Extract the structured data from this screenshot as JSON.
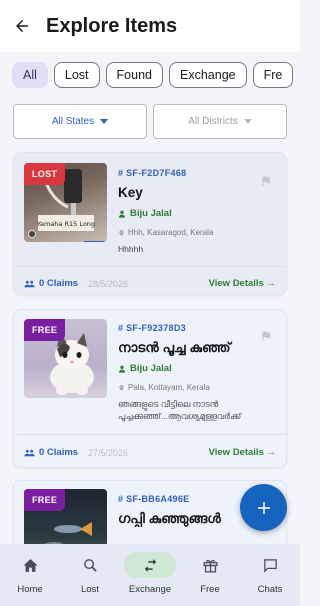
{
  "header": {
    "title": "Explore Items",
    "back_icon": "arrow-left-icon"
  },
  "filters": {
    "chips": [
      {
        "label": "All",
        "active": true
      },
      {
        "label": "Lost",
        "active": false
      },
      {
        "label": "Found",
        "active": false
      },
      {
        "label": "Exchange",
        "active": false
      },
      {
        "label": "Fre",
        "active": false
      }
    ],
    "state_dropdown": {
      "label": "All States"
    },
    "district_dropdown": {
      "label": "All Districts"
    }
  },
  "items": [
    {
      "badge": "LOST",
      "id": "# SF-F2D7F468",
      "title": "Key",
      "owner": "Biju Jalal",
      "location": "Hhh, Kasaragod, Kerala",
      "description": "Hhhhh",
      "claims": "0 Claims",
      "date": "28/5/2026",
      "action": "View Details →",
      "thumb_caption": "Yamaha R15 Long"
    },
    {
      "badge": "FREE",
      "id": "# SF-F92378D3",
      "title": "നാടൻ പൂച്ച കുഞ്ഞ്",
      "owner": "Biju Jalal",
      "location": "Pala, Kottayam, Kerala",
      "description": "ഞങ്ങളുടെ വീട്ടിലെ നാടൻ പൂച്ചക്കുഞ്ഞ്...ആവശ്യമുള്ളവർക്ക്",
      "claims": "0 Claims",
      "date": "27/5/2026",
      "action": "View Details →"
    },
    {
      "badge": "FREE",
      "id": "# SF-BB6A496E",
      "title": "ഗപ്പി കുഞ്ഞുങ്ങൾ"
    }
  ],
  "fab": {
    "icon": "plus-icon"
  },
  "bottom_nav": [
    {
      "label": "Home",
      "icon": "home-icon",
      "active": false
    },
    {
      "label": "Lost",
      "icon": "search-icon",
      "active": false
    },
    {
      "label": "Exchange",
      "icon": "swap-icon",
      "active": true
    },
    {
      "label": "Free",
      "icon": "gift-icon",
      "active": false
    },
    {
      "label": "Chats",
      "icon": "chat-icon",
      "active": false
    }
  ],
  "colors": {
    "accent": "#2f5fc0",
    "owner_green": "#2e7d32",
    "lost_badge": "#d9363e",
    "free_badge": "#7b1fa2",
    "fab": "#1565c0"
  }
}
